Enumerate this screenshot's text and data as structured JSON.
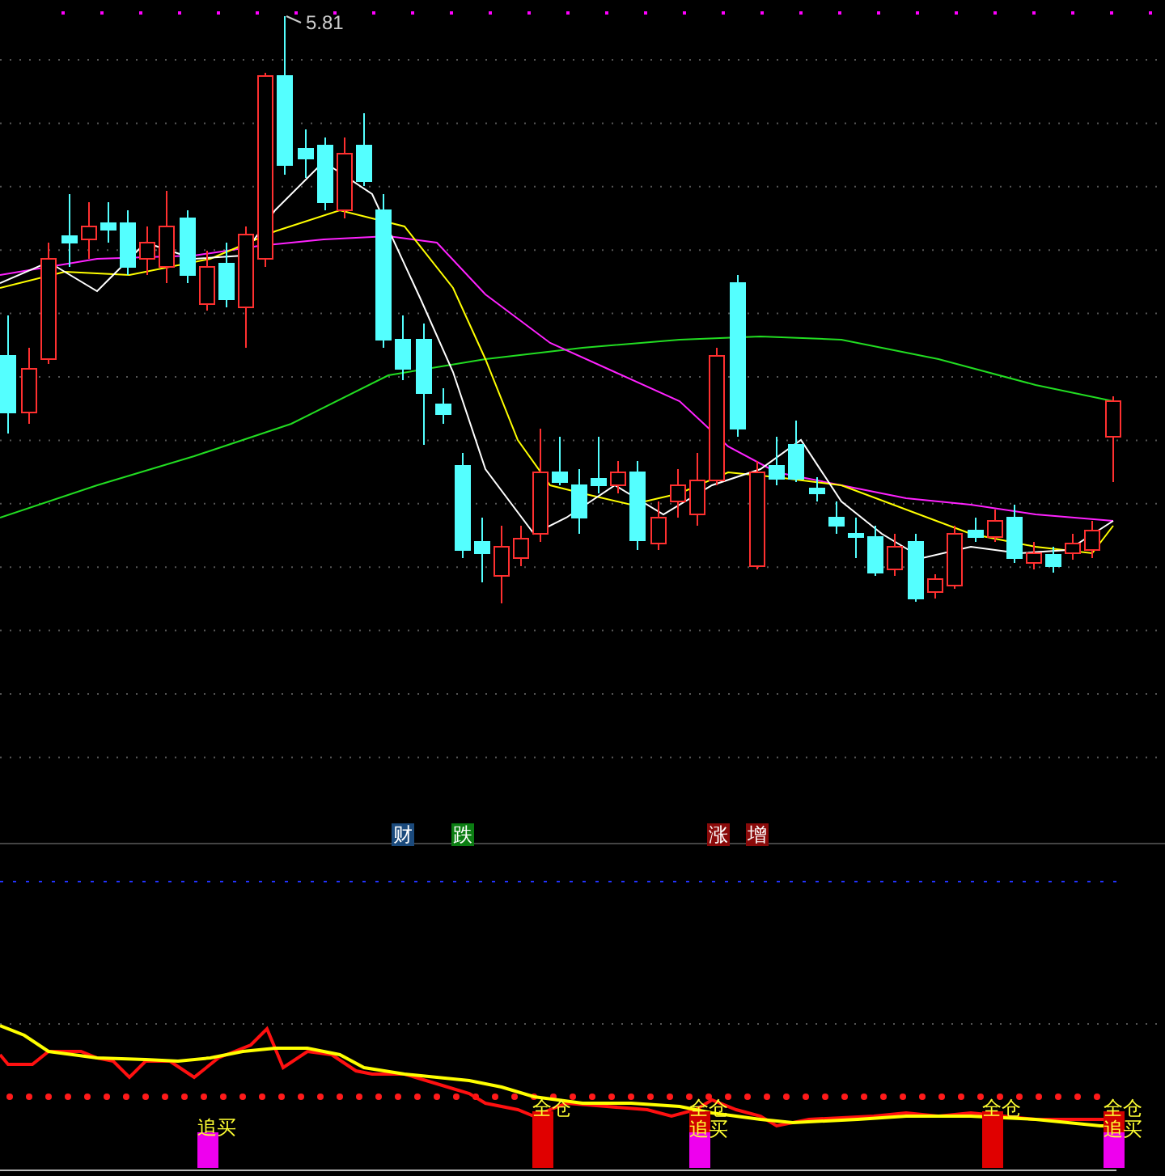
{
  "price_panel": {
    "high_label": "5.81",
    "markers": [
      {
        "text": "财",
        "color": "#1b4a7c"
      },
      {
        "text": "跌",
        "color": "#0b7d12"
      },
      {
        "text": "涨",
        "color": "#8a0a0a"
      },
      {
        "text": "增",
        "color": "#8a0a0a"
      }
    ]
  },
  "indicator_panel": {
    "signals": [
      {
        "kind": "chase",
        "labels": [
          "追买"
        ]
      },
      {
        "kind": "full",
        "labels": [
          "全仓"
        ]
      },
      {
        "kind": "both",
        "labels": [
          "全仓",
          "追买"
        ]
      },
      {
        "kind": "full",
        "labels": [
          "全仓"
        ]
      },
      {
        "kind": "both",
        "labels": [
          "全仓",
          "追买"
        ]
      }
    ]
  }
}
